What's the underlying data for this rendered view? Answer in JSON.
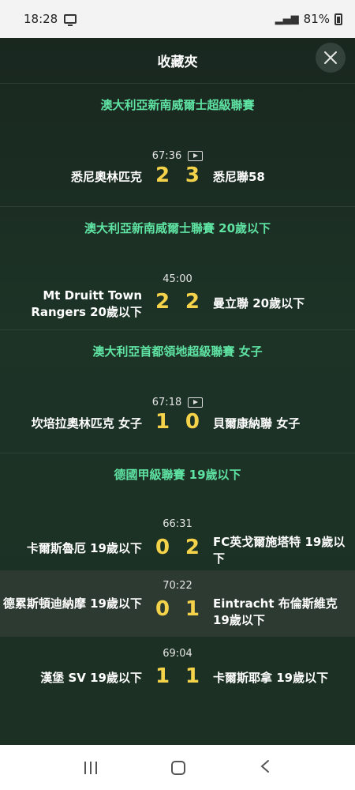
{
  "status_bar": {
    "time": "18:28",
    "battery": "81%"
  },
  "header": {
    "title": "收藏夾"
  },
  "leagues": [
    {
      "name": "澳大利亞新南威爾士超級聯賽",
      "matches": [
        {
          "time": "67:36",
          "video": true,
          "home": "悉尼奧林匹克",
          "home_score": "2",
          "away_score": "3",
          "away": "悉尼聯58"
        }
      ]
    },
    {
      "name": "澳大利亞新南威爾士聯賽 20歲以下",
      "matches": [
        {
          "time": "45:00",
          "video": false,
          "home": "Mt Druitt Town Rangers 20歲以下",
          "home_score": "2",
          "away_score": "2",
          "away": "曼立聯 20歲以下"
        }
      ]
    },
    {
      "name": "澳大利亞首都領地超級聯賽 女子",
      "matches": [
        {
          "time": "67:18",
          "video": true,
          "home": "坎培拉奧林匹克 女子",
          "home_score": "1",
          "away_score": "0",
          "away": "貝爾康納聯 女子"
        }
      ]
    },
    {
      "name": "德國甲級聯賽 19歲以下",
      "matches": [
        {
          "time": "66:31",
          "video": false,
          "home": "卡爾斯魯厄 19歲以下",
          "home_score": "0",
          "away_score": "2",
          "away": "FC英戈爾施塔特 19歲以下"
        },
        {
          "time": "70:22",
          "video": false,
          "home": "德累斯頓迪納摩 19歲以下",
          "home_score": "0",
          "away_score": "1",
          "away": "Eintracht 布倫斯維克 19歲以下"
        },
        {
          "time": "69:04",
          "video": false,
          "home": "漢堡 SV 19歲以下",
          "home_score": "1",
          "away_score": "1",
          "away": "卡爾斯耶拿 19歲以下"
        }
      ]
    }
  ]
}
